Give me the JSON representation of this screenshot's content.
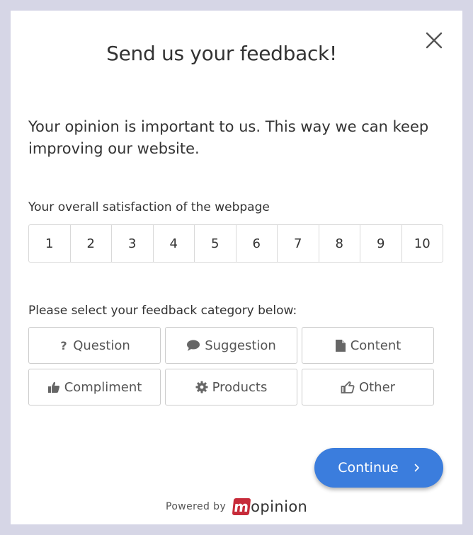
{
  "modal": {
    "title": "Send us your feedback!",
    "intro": "Your opinion is important to us. This way we can keep improving our website.",
    "close_icon": "close-icon"
  },
  "rating": {
    "label": "Your overall satisfaction of the webpage",
    "options": [
      "1",
      "2",
      "3",
      "4",
      "5",
      "6",
      "7",
      "8",
      "9",
      "10"
    ]
  },
  "category": {
    "label": "Please select your feedback category below:",
    "options": [
      {
        "label": "Question",
        "icon": "question-icon"
      },
      {
        "label": "Suggestion",
        "icon": "speech-bubble-icon"
      },
      {
        "label": "Content",
        "icon": "file-icon"
      },
      {
        "label": "Compliment",
        "icon": "thumbs-up-icon"
      },
      {
        "label": "Products",
        "icon": "gear-icon"
      },
      {
        "label": "Other",
        "icon": "pointing-hand-icon"
      }
    ]
  },
  "continue_button": {
    "label": "Continue",
    "icon": "chevron-right-icon",
    "color": "#3b7ddd"
  },
  "footer": {
    "powered_by": "Powered by",
    "brand_mark": "m",
    "brand_rest": "opinion",
    "brand_color": "#c72b3a"
  }
}
